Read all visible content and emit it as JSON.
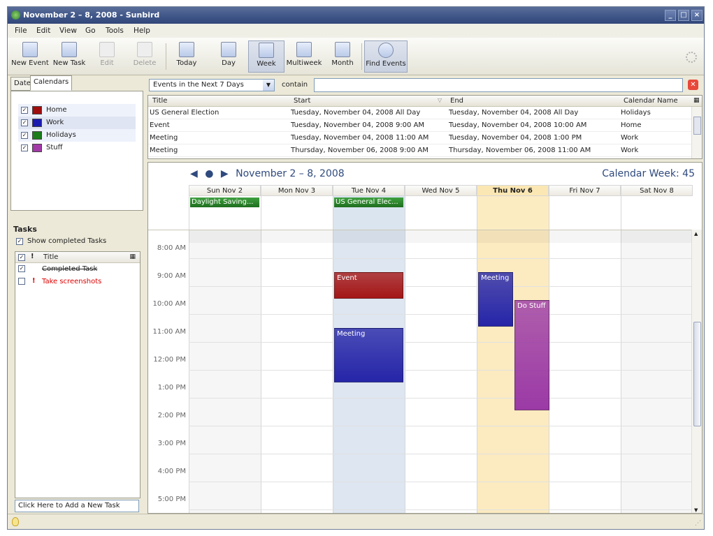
{
  "window": {
    "title": "November 2 – 8, 2008 - Sunbird",
    "minimize": "_",
    "maximize": "□",
    "close": "×"
  },
  "menu": [
    "File",
    "Edit",
    "View",
    "Go",
    "Tools",
    "Help"
  ],
  "toolbar": {
    "new_event": "New Event",
    "new_task": "New Task",
    "edit": "Edit",
    "delete": "Delete",
    "today": "Today",
    "day": "Day",
    "week": "Week",
    "multiweek": "Multiweek",
    "month": "Month",
    "find_events": "Find Events"
  },
  "left": {
    "tabs": [
      "Date",
      "Calendars"
    ],
    "calendars": [
      {
        "name": "Home",
        "color": "#a00d0d"
      },
      {
        "name": "Work",
        "color": "#1b1bb0"
      },
      {
        "name": "Holidays",
        "color": "#1a7d1a"
      },
      {
        "name": "Stuff",
        "color": "#a23aa8"
      }
    ],
    "tasks_heading": "Tasks",
    "show_completed": "Show completed Tasks",
    "task_column_title": "Title",
    "tasks": [
      {
        "title": "Completed Task",
        "done": true
      },
      {
        "title": "Take screenshots",
        "done": false,
        "priority": "!"
      }
    ],
    "new_task_placeholder": "Click Here to Add a New Task"
  },
  "filter": {
    "selected": "Events in the Next 7 Days",
    "contain_label": "contain",
    "contain_value": ""
  },
  "event_list": {
    "columns": [
      "Title",
      "Start",
      "End",
      "Calendar Name"
    ],
    "rows": [
      {
        "title": "US General Election",
        "start": "Tuesday, November 04, 2008 All Day",
        "end": "Tuesday, November 04, 2008 All Day",
        "calendar": "Holidays"
      },
      {
        "title": "Event",
        "start": "Tuesday, November 04, 2008 9:00 AM",
        "end": "Tuesday, November 04, 2008 10:00 AM",
        "calendar": "Home"
      },
      {
        "title": "Meeting",
        "start": "Tuesday, November 04, 2008 11:00 AM",
        "end": "Tuesday, November 04, 2008 1:00 PM",
        "calendar": "Work"
      },
      {
        "title": "Meeting",
        "start": "Thursday, November 06, 2008 9:00 AM",
        "end": "Thursday, November 06, 2008 11:00 AM",
        "calendar": "Work"
      }
    ]
  },
  "week_view": {
    "range_label": "November 2 – 8, 2008",
    "nav_prev": "◀",
    "nav_today": "●",
    "nav_next": "▶",
    "week_label": "Calendar Week: 45",
    "days": [
      "Sun Nov 2",
      "Mon Nov 3",
      "Tue Nov 4",
      "Wed Nov 5",
      "Thu Nov 6",
      "Fri Nov 7",
      "Sat Nov 8"
    ],
    "today_index": 4,
    "selected_index": 2,
    "all_day_events": [
      {
        "day": 0,
        "title": "Daylight Saving..."
      },
      {
        "day": 2,
        "title": "US General Elec..."
      }
    ],
    "hours": [
      "8:00 AM",
      "9:00 AM",
      "10:00 AM",
      "11:00 AM",
      "12:00 PM",
      "1:00 PM",
      "2:00 PM",
      "3:00 PM",
      "4:00 PM",
      "5:00 PM"
    ],
    "events": [
      {
        "title": "Event",
        "day": 2,
        "start": 9,
        "end": 10,
        "color": "#a41616"
      },
      {
        "title": "Meeting",
        "day": 2,
        "start": 11,
        "end": 13,
        "color": "#2525a8"
      },
      {
        "title": "Meeting",
        "day": 4,
        "start": 9,
        "end": 11,
        "color": "#2525a8"
      },
      {
        "title": "Do Stuff",
        "day": 4,
        "start": 10,
        "end": 14,
        "color": "#9b3aa6"
      }
    ]
  }
}
